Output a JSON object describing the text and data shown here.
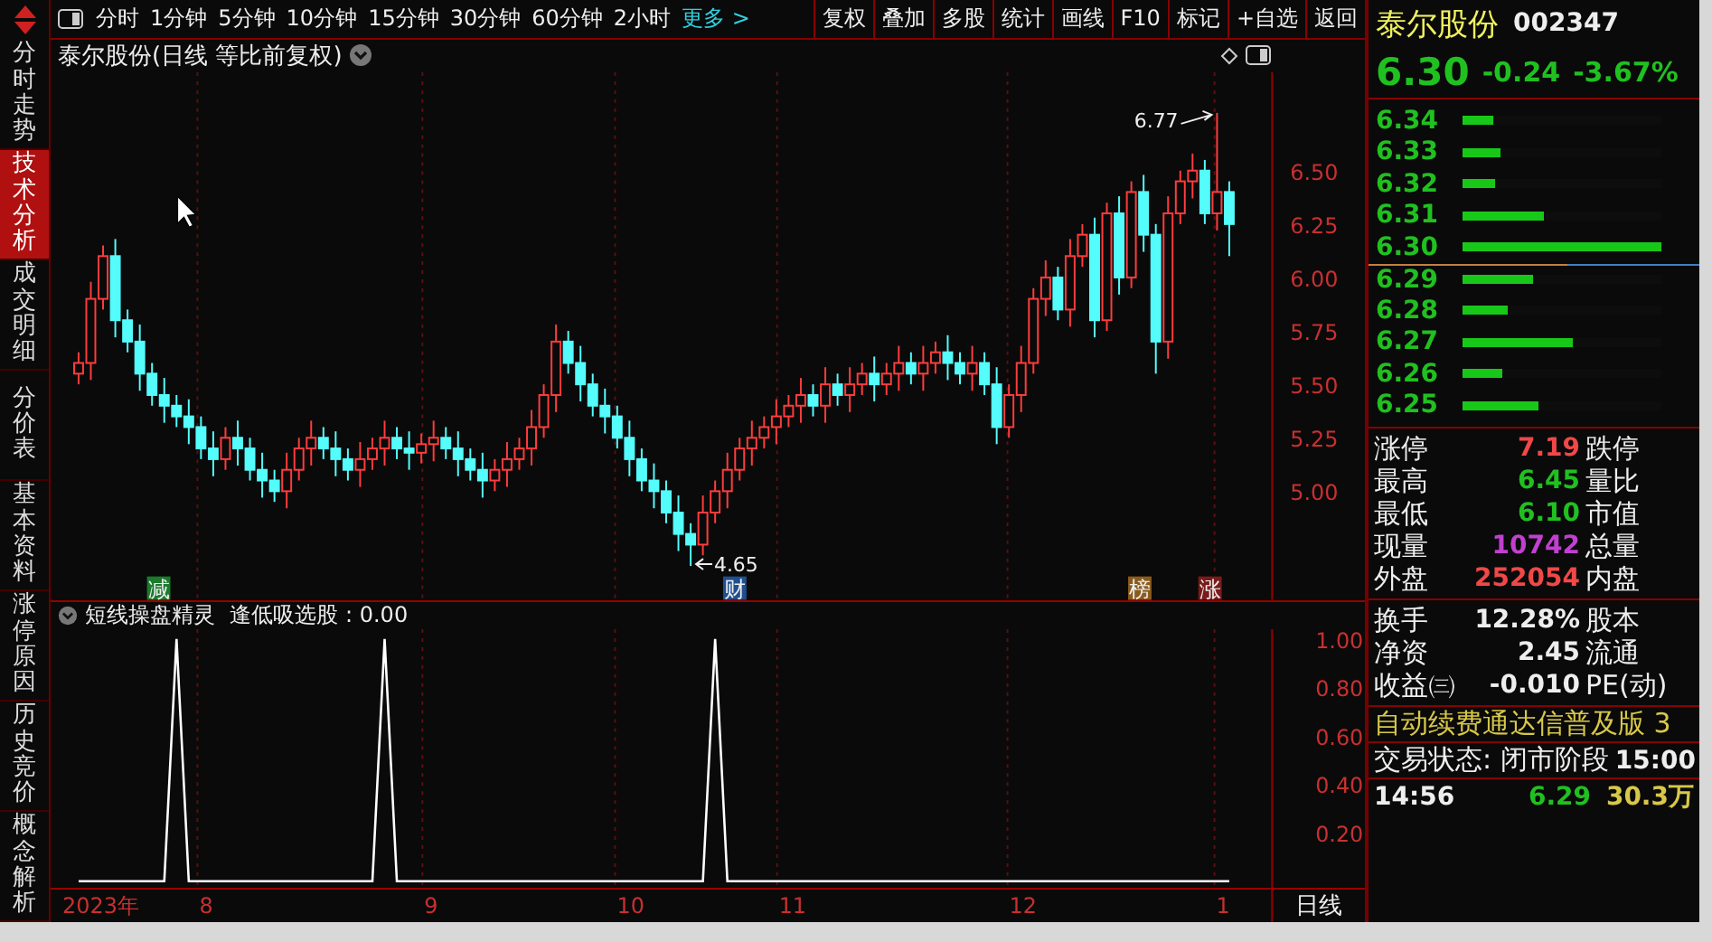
{
  "sidebar_tabs": [
    {
      "label": "分时走势",
      "selected": false
    },
    {
      "label": "技术分析",
      "selected": true
    },
    {
      "label": "成交明细",
      "selected": false
    },
    {
      "label": "分价表",
      "selected": false
    },
    {
      "label": "基本资料",
      "selected": false
    },
    {
      "label": "涨停原因",
      "selected": false
    },
    {
      "label": "历史竞价",
      "selected": false
    },
    {
      "label": "概念解析",
      "selected": false
    }
  ],
  "toolbar": {
    "periods": [
      "分时",
      "1分钟",
      "5分钟",
      "10分钟",
      "15分钟",
      "30分钟",
      "60分钟",
      "2小时"
    ],
    "more": "更多 >",
    "buttons": [
      "复权",
      "叠加",
      "多股",
      "统计",
      "画线",
      "F10",
      "标记",
      "+自选",
      "返回"
    ]
  },
  "chart": {
    "title": "泰尔股份(日线 等比前复权)",
    "high_label": "6.77",
    "low_label": "4.65",
    "markers": [
      {
        "label": "减",
        "color": "#1c7a2c"
      },
      {
        "label": "财",
        "color": "#1f4f8f"
      },
      {
        "label": "榜",
        "color": "#8a5a1c"
      },
      {
        "label": "涨",
        "color": "#7a1a1a"
      }
    ],
    "chart_data": {
      "type": "candlestick",
      "ylim": [
        4.5,
        6.96
      ],
      "grid": true,
      "yticks": [
        {
          "value": 6.5,
          "label": "6.50"
        },
        {
          "value": 6.25,
          "label": "6.25"
        },
        {
          "value": 6.0,
          "label": "6.00"
        },
        {
          "value": 5.75,
          "label": "5.75"
        },
        {
          "value": 5.5,
          "label": "5.50"
        },
        {
          "value": 5.25,
          "label": "5.25"
        },
        {
          "value": 5.0,
          "label": "5.00"
        }
      ],
      "ohlc": [
        [
          5.55,
          5.65,
          5.5,
          5.6
        ],
        [
          5.6,
          5.98,
          5.52,
          5.9
        ],
        [
          5.9,
          6.15,
          5.85,
          6.1
        ],
        [
          6.1,
          6.18,
          5.72,
          5.8
        ],
        [
          5.8,
          5.85,
          5.65,
          5.7
        ],
        [
          5.7,
          5.78,
          5.47,
          5.55
        ],
        [
          5.55,
          5.6,
          5.4,
          5.45
        ],
        [
          5.45,
          5.53,
          5.32,
          5.4
        ],
        [
          5.4,
          5.45,
          5.3,
          5.35
        ],
        [
          5.35,
          5.43,
          5.22,
          5.3
        ],
        [
          5.3,
          5.35,
          5.15,
          5.2
        ],
        [
          5.2,
          5.28,
          5.07,
          5.15
        ],
        [
          5.15,
          5.3,
          5.1,
          5.25
        ],
        [
          5.25,
          5.33,
          5.12,
          5.2
        ],
        [
          5.2,
          5.25,
          5.05,
          5.1
        ],
        [
          5.1,
          5.18,
          4.97,
          5.05
        ],
        [
          5.05,
          5.1,
          4.95,
          5.0
        ],
        [
          5.0,
          5.18,
          4.92,
          5.1
        ],
        [
          5.1,
          5.25,
          5.05,
          5.2
        ],
        [
          5.2,
          5.33,
          5.12,
          5.25
        ],
        [
          5.25,
          5.3,
          5.15,
          5.2
        ],
        [
          5.2,
          5.28,
          5.07,
          5.15
        ],
        [
          5.15,
          5.2,
          5.05,
          5.1
        ],
        [
          5.1,
          5.23,
          5.02,
          5.15
        ],
        [
          5.15,
          5.25,
          5.1,
          5.2
        ],
        [
          5.2,
          5.33,
          5.12,
          5.25
        ],
        [
          5.25,
          5.3,
          5.15,
          5.2
        ],
        [
          5.2,
          5.28,
          5.1,
          5.18
        ],
        [
          5.18,
          5.27,
          5.13,
          5.22
        ],
        [
          5.22,
          5.33,
          5.14,
          5.25
        ],
        [
          5.25,
          5.3,
          5.15,
          5.2
        ],
        [
          5.2,
          5.28,
          5.07,
          5.15
        ],
        [
          5.15,
          5.2,
          5.05,
          5.1
        ],
        [
          5.1,
          5.18,
          4.97,
          5.05
        ],
        [
          5.05,
          5.15,
          5.0,
          5.1
        ],
        [
          5.1,
          5.23,
          5.02,
          5.15
        ],
        [
          5.15,
          5.25,
          5.1,
          5.2
        ],
        [
          5.2,
          5.38,
          5.12,
          5.3
        ],
        [
          5.3,
          5.5,
          5.25,
          5.45
        ],
        [
          5.45,
          5.78,
          5.37,
          5.7
        ],
        [
          5.7,
          5.75,
          5.55,
          5.6
        ],
        [
          5.6,
          5.68,
          5.42,
          5.5
        ],
        [
          5.5,
          5.55,
          5.35,
          5.4
        ],
        [
          5.4,
          5.48,
          5.27,
          5.35
        ],
        [
          5.35,
          5.4,
          5.2,
          5.25
        ],
        [
          5.25,
          5.33,
          5.07,
          5.15
        ],
        [
          5.15,
          5.2,
          5.0,
          5.05
        ],
        [
          5.05,
          5.13,
          4.92,
          5.0
        ],
        [
          5.0,
          5.05,
          4.85,
          4.9
        ],
        [
          4.9,
          4.98,
          4.72,
          4.8
        ],
        [
          4.8,
          4.85,
          4.65,
          4.75
        ],
        [
          4.75,
          4.98,
          4.7,
          4.9
        ],
        [
          4.9,
          5.05,
          4.85,
          5.0
        ],
        [
          5.0,
          5.18,
          4.92,
          5.1
        ],
        [
          5.1,
          5.25,
          5.05,
          5.2
        ],
        [
          5.2,
          5.33,
          5.12,
          5.25
        ],
        [
          5.25,
          5.35,
          5.2,
          5.3
        ],
        [
          5.3,
          5.43,
          5.22,
          5.35
        ],
        [
          5.35,
          5.45,
          5.3,
          5.4
        ],
        [
          5.4,
          5.53,
          5.32,
          5.45
        ],
        [
          5.45,
          5.5,
          5.35,
          5.4
        ],
        [
          5.4,
          5.58,
          5.32,
          5.5
        ],
        [
          5.5,
          5.55,
          5.4,
          5.45
        ],
        [
          5.45,
          5.58,
          5.37,
          5.5
        ],
        [
          5.5,
          5.6,
          5.45,
          5.55
        ],
        [
          5.55,
          5.63,
          5.42,
          5.5
        ],
        [
          5.5,
          5.6,
          5.45,
          5.55
        ],
        [
          5.55,
          5.68,
          5.47,
          5.6
        ],
        [
          5.6,
          5.65,
          5.5,
          5.55
        ],
        [
          5.55,
          5.68,
          5.47,
          5.6
        ],
        [
          5.6,
          5.7,
          5.55,
          5.65
        ],
        [
          5.65,
          5.73,
          5.52,
          5.6
        ],
        [
          5.6,
          5.65,
          5.5,
          5.55
        ],
        [
          5.55,
          5.68,
          5.47,
          5.6
        ],
        [
          5.6,
          5.65,
          5.45,
          5.5
        ],
        [
          5.5,
          5.58,
          5.22,
          5.3
        ],
        [
          5.3,
          5.5,
          5.25,
          5.45
        ],
        [
          5.45,
          5.68,
          5.37,
          5.6
        ],
        [
          5.6,
          5.95,
          5.55,
          5.9
        ],
        [
          5.9,
          6.08,
          5.82,
          6.0
        ],
        [
          6.0,
          6.05,
          5.8,
          5.85
        ],
        [
          5.85,
          6.18,
          5.77,
          6.1
        ],
        [
          6.1,
          6.25,
          6.05,
          6.2
        ],
        [
          6.2,
          6.28,
          5.72,
          5.8
        ],
        [
          5.8,
          6.35,
          5.75,
          6.3
        ],
        [
          6.3,
          6.38,
          5.92,
          6.0
        ],
        [
          6.0,
          6.45,
          5.95,
          6.4
        ],
        [
          6.4,
          6.48,
          6.12,
          6.2
        ],
        [
          6.2,
          6.25,
          5.55,
          5.7
        ],
        [
          5.7,
          6.38,
          5.62,
          6.3
        ],
        [
          6.3,
          6.5,
          6.25,
          6.45
        ],
        [
          6.45,
          6.58,
          6.37,
          6.5
        ],
        [
          6.5,
          6.55,
          6.25,
          6.3
        ],
        [
          6.3,
          6.77,
          6.22,
          6.4
        ],
        [
          6.4,
          6.45,
          6.1,
          6.25
        ]
      ]
    }
  },
  "indicator": {
    "title": "短线操盘精灵",
    "readout": ": 0.00",
    "chart_data": {
      "type": "line",
      "ylim": [
        -0.03,
        1.04
      ],
      "grid": true,
      "yticks": [
        {
          "value": 1,
          "label": "1.00"
        },
        {
          "value": 0.8,
          "label": "0.80"
        },
        {
          "value": 0.6,
          "label": "0.60"
        },
        {
          "value": 0.4,
          "label": "0.40"
        },
        {
          "value": 0.2,
          "label": "0.20"
        }
      ],
      "series": [
        {
          "name": "逢低吸选股",
          "color": "#ffffff",
          "values": [
            0,
            0,
            0,
            0,
            0,
            0,
            0,
            0,
            1,
            0,
            0,
            0,
            0,
            0,
            0,
            0,
            0,
            0,
            0,
            0,
            0,
            0,
            0,
            0,
            0,
            1,
            0,
            0,
            0,
            0,
            0,
            0,
            0,
            0,
            0,
            0,
            0,
            0,
            0,
            0,
            0,
            0,
            0,
            0,
            0,
            0,
            0,
            0,
            0,
            0,
            0,
            0,
            1,
            0,
            0,
            0,
            0,
            0,
            0,
            0,
            0,
            0,
            0,
            0,
            0,
            0,
            0,
            0,
            0,
            0,
            0,
            0,
            0,
            0,
            0,
            0,
            0,
            0,
            0,
            0,
            0,
            0,
            0,
            0,
            0,
            0,
            0,
            0,
            0,
            0,
            0,
            0,
            0,
            0,
            0
          ]
        }
      ]
    }
  },
  "time_axis": {
    "labels": [
      "2023年",
      "8",
      "9",
      "10",
      "11",
      "12",
      "1"
    ],
    "period": "日线"
  },
  "quote": {
    "name": "泰尔股份",
    "code": "002347",
    "price": "6.30",
    "change": "-0.24",
    "change_pct": "-3.67%",
    "order_book": [
      {
        "price": "6.34",
        "level": 0.15,
        "kind": "ask"
      },
      {
        "price": "6.33",
        "level": 0.19,
        "kind": "ask"
      },
      {
        "price": "6.32",
        "level": 0.16,
        "kind": "ask"
      },
      {
        "price": "6.31",
        "level": 0.41,
        "kind": "ask"
      },
      {
        "price": "6.30",
        "level": 1,
        "kind": "ask"
      },
      {
        "price": "6.29",
        "level": 0.35,
        "kind": "bid"
      },
      {
        "price": "6.28",
        "level": 0.23,
        "kind": "bid"
      },
      {
        "price": "6.27",
        "level": 0.55,
        "kind": "bid"
      },
      {
        "price": "6.26",
        "level": 0.2,
        "kind": "bid"
      },
      {
        "price": "6.25",
        "level": 0.38,
        "kind": "bid"
      }
    ],
    "stats": [
      {
        "label": "涨停",
        "value": "7.19",
        "color": "#f04848",
        "label2": "跌停"
      },
      {
        "label": "最高",
        "value": "6.45",
        "color": "#20c020",
        "label2": "量比"
      },
      {
        "label": "最低",
        "value": "6.10",
        "color": "#20c020",
        "label2": "市值"
      },
      {
        "label": "现量",
        "value": "10742",
        "color": "#c040d0",
        "label2": "总量"
      },
      {
        "label": "外盘",
        "value": "252054",
        "color": "#f04848",
        "label2": "内盘"
      }
    ],
    "fundamentals": [
      {
        "label": "换手",
        "value": "12.28%",
        "label2": "股本"
      },
      {
        "label": "净资",
        "value": "2.45",
        "label2": "流通"
      },
      {
        "label": "收益㈢",
        "value": "-0.010",
        "label2": "PE(动)"
      }
    ],
    "notice": "自动续费通达信普及版 3",
    "trade_status": "交易状态: 闭市阶段",
    "trade_time": "15:00",
    "ticks": [
      {
        "time": "14:56",
        "price": "6.29",
        "volume": "30.3万"
      }
    ]
  }
}
